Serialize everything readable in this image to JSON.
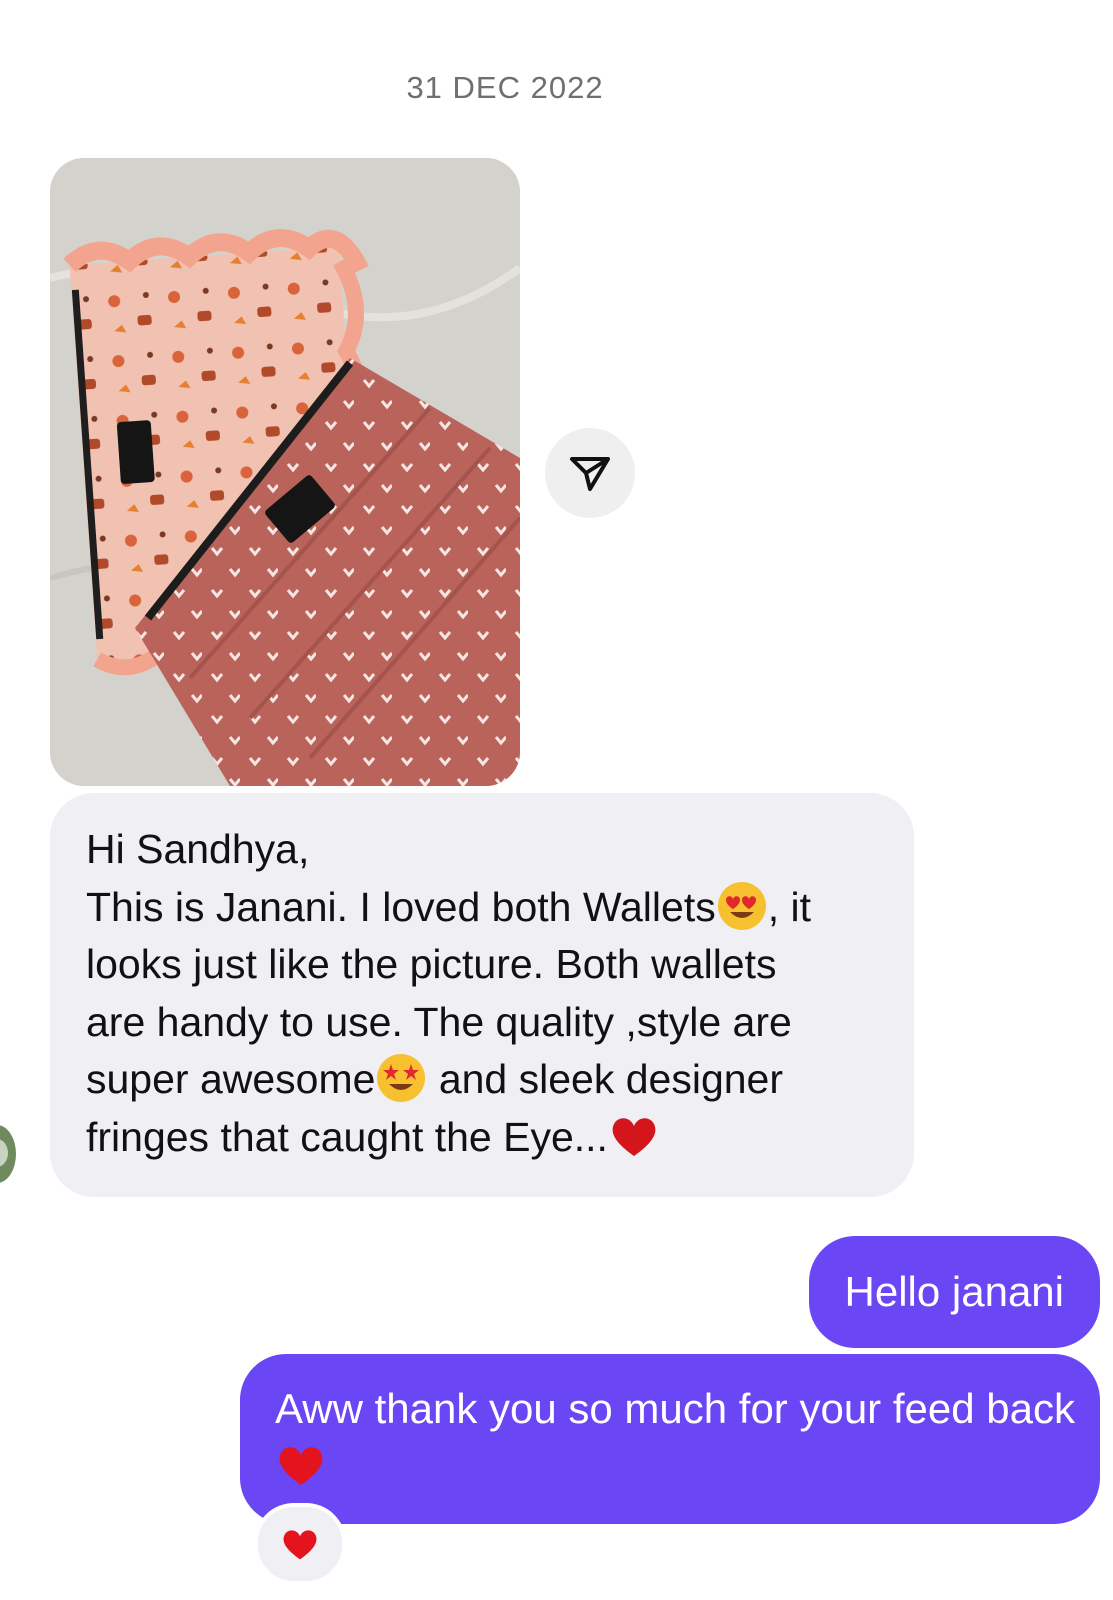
{
  "chat": {
    "date_separator": "31 DEC 2022",
    "incoming": {
      "line1": "Hi Sandhya,",
      "line2a": "This is Janani. I loved both Wallets",
      "line2b": ", it",
      "line3": "looks just like the picture. Both wallets",
      "line4": "are handy to use. The quality ,style are",
      "line5a": "super awesome",
      "line5b": " and sleek designer",
      "line6": "fringes that caught the Eye..."
    },
    "outgoing": [
      {
        "text": "Hello janani"
      },
      {
        "text": "Aww thank you so much for your feed back "
      }
    ]
  },
  "icons": {
    "share": "paper-plane-icon",
    "reaction": "red-heart-icon",
    "emojis": [
      "heart-eyes-emoji",
      "star-struck-emoji",
      "red-heart-emoji"
    ]
  },
  "colors": {
    "outgoing_bubble": "#6b46f5",
    "incoming_bubble": "#efeff4",
    "date_text": "#6e6e73"
  }
}
